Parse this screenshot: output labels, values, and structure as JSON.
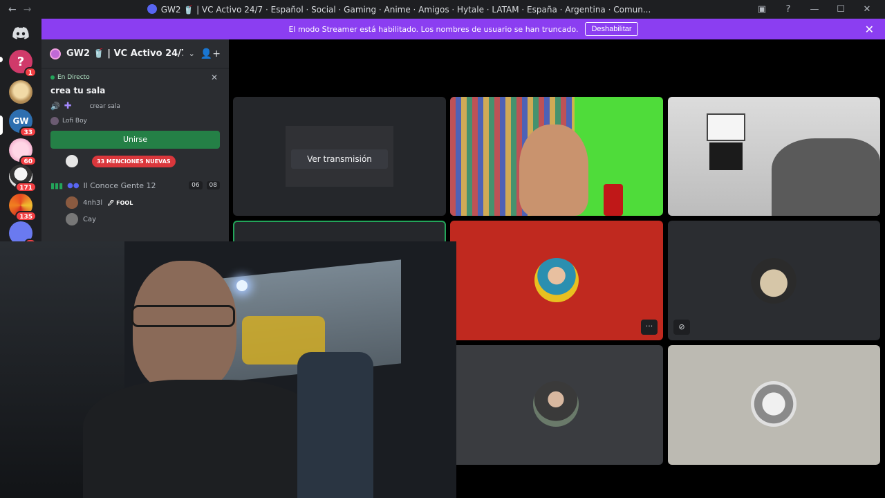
{
  "window": {
    "title": "GW2 🥤 | VC Activo 24/7 · Español · Social · Gaming · Anime · Amigos · Hytale · LATAM · España · Argentina · Comun...",
    "back_glyph": "←",
    "forward_glyph": "→",
    "controls": {
      "inbox": "▣",
      "help": "?",
      "minimize": "—",
      "maximize": "☐",
      "close": "✕"
    }
  },
  "rail": {
    "servers": [
      {
        "name": "unknown-server",
        "badge": "1",
        "color": "#d03a6a"
      },
      {
        "name": "cat-server",
        "badge": "",
        "color": "#c9a770"
      },
      {
        "name": "gw-server",
        "badge": "33",
        "color": "#3a9a6a"
      },
      {
        "name": "anime-server",
        "badge": "60",
        "color": "#f0a8c8"
      },
      {
        "name": "girl-server",
        "badge": "171",
        "color": "#d8d8d8"
      },
      {
        "name": "colorful-server",
        "badge": "135",
        "color": "#d05a20"
      },
      {
        "name": "blue-server",
        "badge": "1",
        "color": "#6a7af0"
      }
    ]
  },
  "banner": {
    "text": "El modo Streamer está habilitado. Los nombres de usuario se han truncado.",
    "button": "Deshabilitar",
    "close": "✕"
  },
  "sidebar": {
    "guild_name": "GW2 🥤 | VC Activo 24/7 · ...",
    "chevron": "⌄",
    "invite_icon": "👤+",
    "live": {
      "status": "En Directo",
      "close": "✕",
      "stage_name": "crea tu sala",
      "topic": "crear sala",
      "speaker": "Lofi Boy",
      "join_button": "Unirse"
    },
    "mentions_badge": "33 MENCIONES NUEVAS",
    "voice_channel": {
      "name": "ll Conoce Gente 12",
      "count_a": "06",
      "count_b": "08"
    },
    "voice_users": [
      {
        "name": "4nh3l",
        "tag": "FOOL"
      },
      {
        "name": "Cay",
        "tag": ""
      }
    ]
  },
  "grid": {
    "watch_stream": "Ver transmisión",
    "more_glyph": "···",
    "nocam_glyph": "⊘"
  },
  "colors": {
    "banner": "#8b3ef1",
    "join": "#248046",
    "red_tile": "#c0291f",
    "mention": "#da373c"
  }
}
